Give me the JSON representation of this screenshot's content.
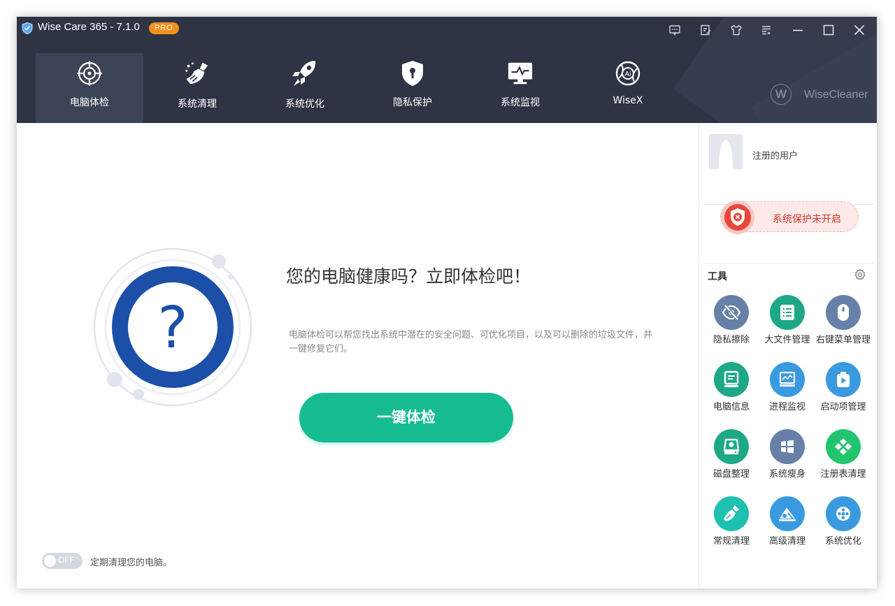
{
  "app": {
    "title": "Wise Care 365 - 7.1.0",
    "badge": "PRO"
  },
  "nav": [
    {
      "label": "电脑体检",
      "icon": "target-icon"
    },
    {
      "label": "系统清理",
      "icon": "broom-icon"
    },
    {
      "label": "系统优化",
      "icon": "rocket-icon"
    },
    {
      "label": "隐私保护",
      "icon": "shield-lock-icon"
    },
    {
      "label": "系统监视",
      "icon": "monitor-icon"
    },
    {
      "label": "WiseX",
      "icon": "ai-icon"
    }
  ],
  "brand": {
    "logo_letter": "W",
    "text": "WiseCleaner"
  },
  "main": {
    "headline": "您的电脑健康吗？立即体检吧！",
    "description": "电脑体检可以帮您找出系统中潜在的安全问题、可优化项目，以及可以删除的垃圾文件，并一键修复它们。",
    "scan_button": "一键体检",
    "hero_symbol": "?",
    "toggle_state": "OFF",
    "toggle_label": "定期清理您的电脑。"
  },
  "side": {
    "user_name": "注册的用户",
    "protection_status": "系统保护未开启",
    "tools_title": "工具",
    "tools": [
      {
        "label": "隐私擦除",
        "icon": "eye-slash-icon",
        "color": "#6680a8"
      },
      {
        "label": "大文件管理",
        "icon": "file-list-icon",
        "color": "#1ea886"
      },
      {
        "label": "右键菜单管理",
        "icon": "mouse-icon",
        "color": "#6680a8"
      },
      {
        "label": "电脑信息",
        "icon": "computer-info-icon",
        "color": "#1ea886"
      },
      {
        "label": "进程监视",
        "icon": "process-monitor-icon",
        "color": "#3a9ae0"
      },
      {
        "label": "启动项管理",
        "icon": "startup-icon",
        "color": "#3a9ae0"
      },
      {
        "label": "磁盘整理",
        "icon": "disk-icon",
        "color": "#1ea886"
      },
      {
        "label": "系统瘦身",
        "icon": "windows-icon",
        "color": "#6680a8"
      },
      {
        "label": "注册表清理",
        "icon": "registry-icon",
        "color": "#22c56e"
      },
      {
        "label": "常规清理",
        "icon": "brush-icon",
        "color": "#1ec0b0"
      },
      {
        "label": "高级清理",
        "icon": "advanced-clean-icon",
        "color": "#3a9ae0"
      },
      {
        "label": "系统优化",
        "icon": "optimize-icon",
        "color": "#3a9ae0"
      }
    ]
  },
  "colors": {
    "header": "#2f3444",
    "accent_green": "#16bc90",
    "hero_blue": "#1c4fa8",
    "pro_orange": "#f5901d",
    "alert_red": "#d8352b"
  }
}
